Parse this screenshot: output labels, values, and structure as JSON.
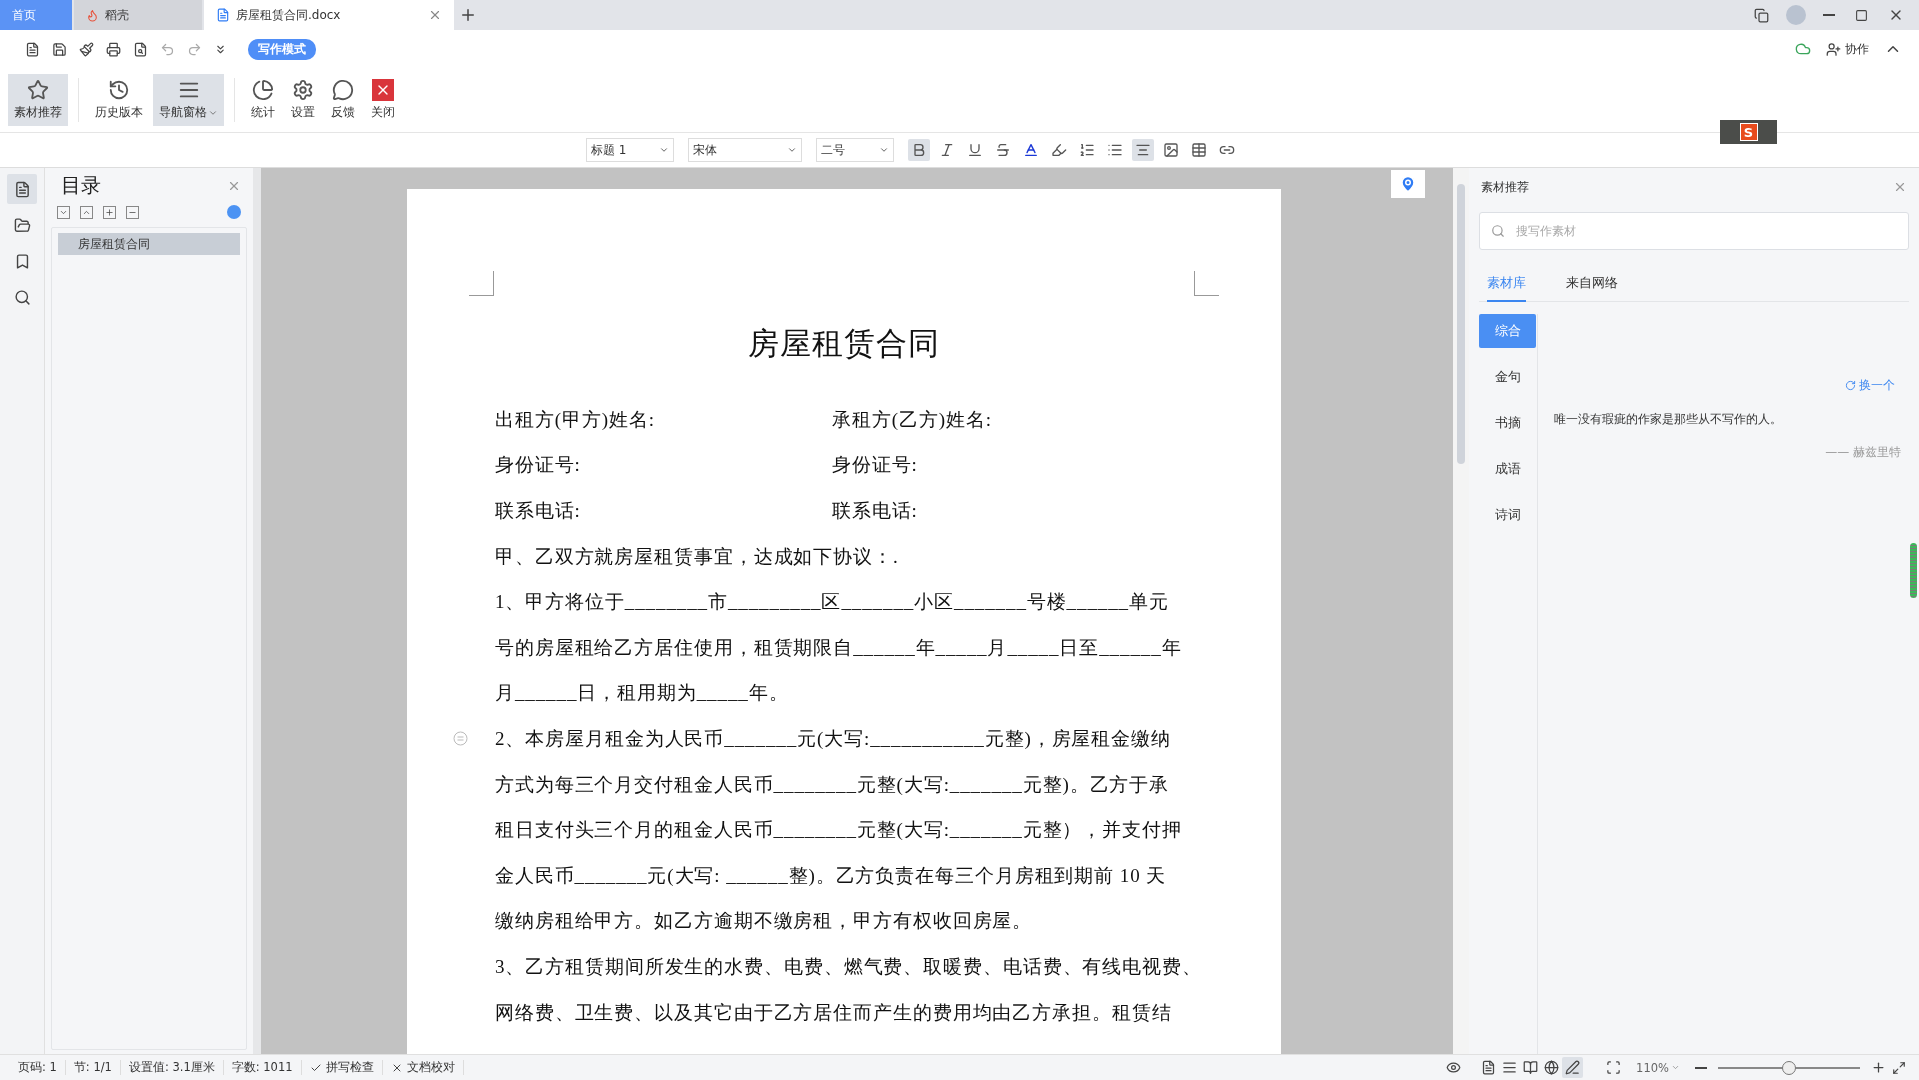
{
  "tabs": [
    {
      "label": "首页",
      "kind": "home",
      "selected": false
    },
    {
      "label": "稻壳",
      "kind": "store",
      "selected": false
    },
    {
      "label": "房屋租赁合同.docx",
      "kind": "doc",
      "selected": true
    }
  ],
  "ime": {
    "logo": "S"
  },
  "quick_toolbar": {
    "mode_button": "写作模式",
    "collab": "协作"
  },
  "ribbon": [
    {
      "label": "素材推荐",
      "kind": "material",
      "selected": true,
      "menu": false
    },
    {
      "label": "历史版本",
      "kind": "history",
      "selected": false,
      "menu": false
    },
    {
      "label": "导航窗格",
      "kind": "nav",
      "selected": true,
      "menu": true
    },
    {
      "label": "统计",
      "kind": "stats",
      "selected": false,
      "menu": false
    },
    {
      "label": "设置",
      "kind": "settings",
      "selected": false,
      "menu": false
    },
    {
      "label": "反馈",
      "kind": "feedback",
      "selected": false,
      "menu": false
    },
    {
      "label": "关闭",
      "kind": "close",
      "selected": false,
      "menu": false
    }
  ],
  "format_toolbar": {
    "style": "标题 1",
    "font": "宋体",
    "size": "二号",
    "tools": [
      {
        "kind": "bold",
        "pressed": true
      },
      {
        "kind": "italic",
        "pressed": false
      },
      {
        "kind": "underline",
        "pressed": false
      },
      {
        "kind": "strike",
        "pressed": false
      },
      {
        "kind": "font-color",
        "pressed": false
      },
      {
        "kind": "highlight",
        "pressed": false
      },
      {
        "kind": "numbered-list",
        "pressed": false
      },
      {
        "kind": "bullet-list",
        "pressed": false
      },
      {
        "kind": "align",
        "pressed": true
      },
      {
        "kind": "image",
        "pressed": false
      },
      {
        "kind": "table",
        "pressed": false
      },
      {
        "kind": "link",
        "pressed": false
      }
    ]
  },
  "side_strip": [
    {
      "kind": "outline",
      "selected": true
    },
    {
      "kind": "folder",
      "selected": false
    },
    {
      "kind": "bookmark",
      "selected": false
    },
    {
      "kind": "search",
      "selected": false
    }
  ],
  "outline": {
    "title": "目录",
    "items": [
      {
        "label": "房屋租赁合同",
        "selected": true
      }
    ]
  },
  "document": {
    "title": "房屋租赁合同",
    "lines": [
      {
        "kind": "pair",
        "left": "出租方(甲方)姓名:",
        "right": "承租方(乙方)姓名:"
      },
      {
        "kind": "pair",
        "left": "身份证号:",
        "right": "身份证号:"
      },
      {
        "kind": "pair",
        "left": "联系电话:",
        "right": "联系电话:"
      },
      {
        "kind": "line",
        "text": "甲、乙双方就房屋租赁事宜，达成如下协议：."
      },
      {
        "kind": "line",
        "text": "1、甲方将位于________市_________区_______小区_______号楼______单元"
      },
      {
        "kind": "line",
        "text": "号的房屋租给乙方居住使用，租赁期限自______年_____月_____日至______年"
      },
      {
        "kind": "line",
        "text": "月______日，租用期为_____年。"
      },
      {
        "kind": "marked",
        "text": "2、本房屋月租金为人民币_______元(大写:___________元整)，房屋租金缴纳"
      },
      {
        "kind": "line",
        "text": "方式为每三个月交付租金人民币________元整(大写:_______元整)。乙方于承"
      },
      {
        "kind": "line",
        "text": "租日支付头三个月的租金人民币________元整(大写:_______元整），并支付押"
      },
      {
        "kind": "line",
        "text": "金人民币_______元(大写: ______整)。乙方负责在每三个月房租到期前 10 天"
      },
      {
        "kind": "line",
        "text": "缴纳房租给甲方。如乙方逾期不缴房租，甲方有权收回房屋。"
      },
      {
        "kind": "line",
        "text": "3、乙方租赁期间所发生的水费、电费、燃气费、取暖费、电话费、有线电视费、"
      },
      {
        "kind": "line",
        "text": "网络费、卫生费、以及其它由于乙方居住而产生的费用均由乙方承担。租赁结"
      }
    ]
  },
  "material_panel": {
    "title": "素材推荐",
    "search": {
      "placeholder": "搜写作素材"
    },
    "tabs": [
      {
        "label": "素材库",
        "selected": true
      },
      {
        "label": "来自网络",
        "selected": false
      }
    ],
    "categories": [
      {
        "label": "综合",
        "selected": true
      },
      {
        "label": "金句",
        "selected": false
      },
      {
        "label": "书摘",
        "selected": false
      },
      {
        "label": "成语",
        "selected": false
      },
      {
        "label": "诗词",
        "selected": false
      }
    ],
    "refresh": "换一个",
    "quote": "唯一没有瑕疵的作家是那些从不写作的人。",
    "author": "—— 赫兹里特"
  },
  "status_bar": {
    "items": [
      {
        "kind": "text",
        "text": "页码: 1"
      },
      {
        "kind": "text",
        "text": "节: 1/1"
      },
      {
        "kind": "text",
        "text": "设置值: 3.1厘米"
      },
      {
        "kind": "text",
        "text": "字数: 1011"
      },
      {
        "kind": "check",
        "text": "拼写检查"
      },
      {
        "kind": "cross",
        "text": "文档校对"
      }
    ],
    "view_modes": [
      {
        "kind": "page",
        "selected": false
      },
      {
        "kind": "outline",
        "selected": false
      },
      {
        "kind": "read",
        "selected": false
      },
      {
        "kind": "web",
        "selected": false
      },
      {
        "kind": "write",
        "selected": true
      }
    ],
    "zoom": "110%",
    "zoom_slider": {
      "level": 0.5
    }
  }
}
